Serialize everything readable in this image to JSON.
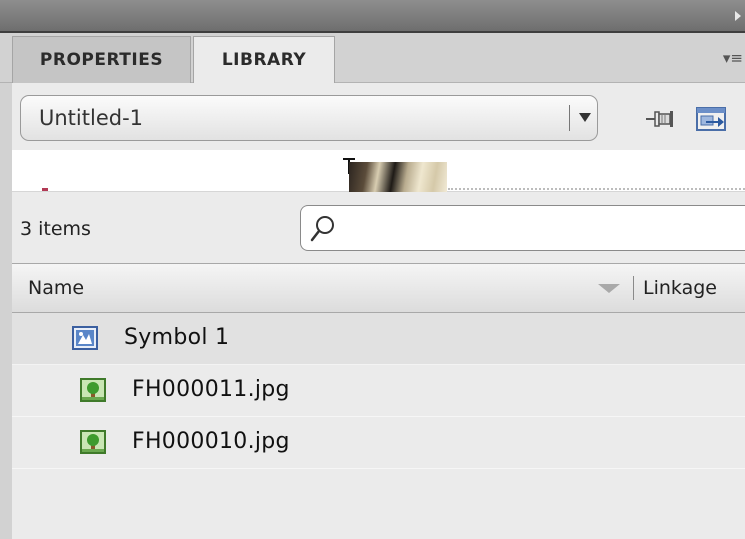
{
  "panel": {
    "tabs": [
      {
        "label": "PROPERTIES",
        "active": false
      },
      {
        "label": "LIBRARY",
        "active": true
      }
    ],
    "menu_icon": "panel-menu-icon"
  },
  "library": {
    "document": "Untitled-1",
    "item_count": "3 items",
    "search": {
      "value": "",
      "placeholder": ""
    },
    "columns": {
      "name": "Name",
      "linkage": "Linkage",
      "sort": "descending"
    },
    "items": [
      {
        "name": "Symbol 1",
        "type": "movie-clip-symbol",
        "icon": "movie-clip-icon",
        "selected": true
      },
      {
        "name": "FH000011.jpg",
        "type": "bitmap",
        "icon": "bitmap-icon",
        "selected": false
      },
      {
        "name": "FH000010.jpg",
        "type": "bitmap",
        "icon": "bitmap-icon",
        "selected": false
      }
    ]
  },
  "colors": {
    "panel_bg": "#ebebeb",
    "tab_active": "#ebebeb",
    "selected_row": "#e1e1e1",
    "topbar": "#7a7a7a"
  }
}
